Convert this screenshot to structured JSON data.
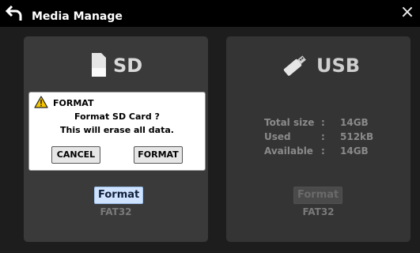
{
  "window": {
    "title": "Media Manage",
    "close_glyph": "×"
  },
  "sd": {
    "label": "SD",
    "format_button": "Format",
    "filesystem": "FAT32"
  },
  "usb": {
    "label": "USB",
    "info": [
      {
        "key": "Total size",
        "sep": ":",
        "value": "14GB"
      },
      {
        "key": "Used",
        "sep": ":",
        "value": "512kB"
      },
      {
        "key": "Available",
        "sep": ":",
        "value": "14GB"
      }
    ],
    "format_button": "Format",
    "filesystem": "FAT32"
  },
  "dialog": {
    "title": "FORMAT",
    "message_line1": "Format SD Card ?",
    "message_line2": "This will erase all data.",
    "cancel_label": "CANCEL",
    "format_label": "FORMAT"
  },
  "icons": [
    "back-arrow-icon",
    "close-icon",
    "sd-card-icon",
    "usb-stick-icon",
    "warning-icon"
  ],
  "colors": {
    "accent_button": "#cfe3ff",
    "panel": "#3a3a3a",
    "background": "#1d1d1d",
    "warning": "#f5c400"
  }
}
